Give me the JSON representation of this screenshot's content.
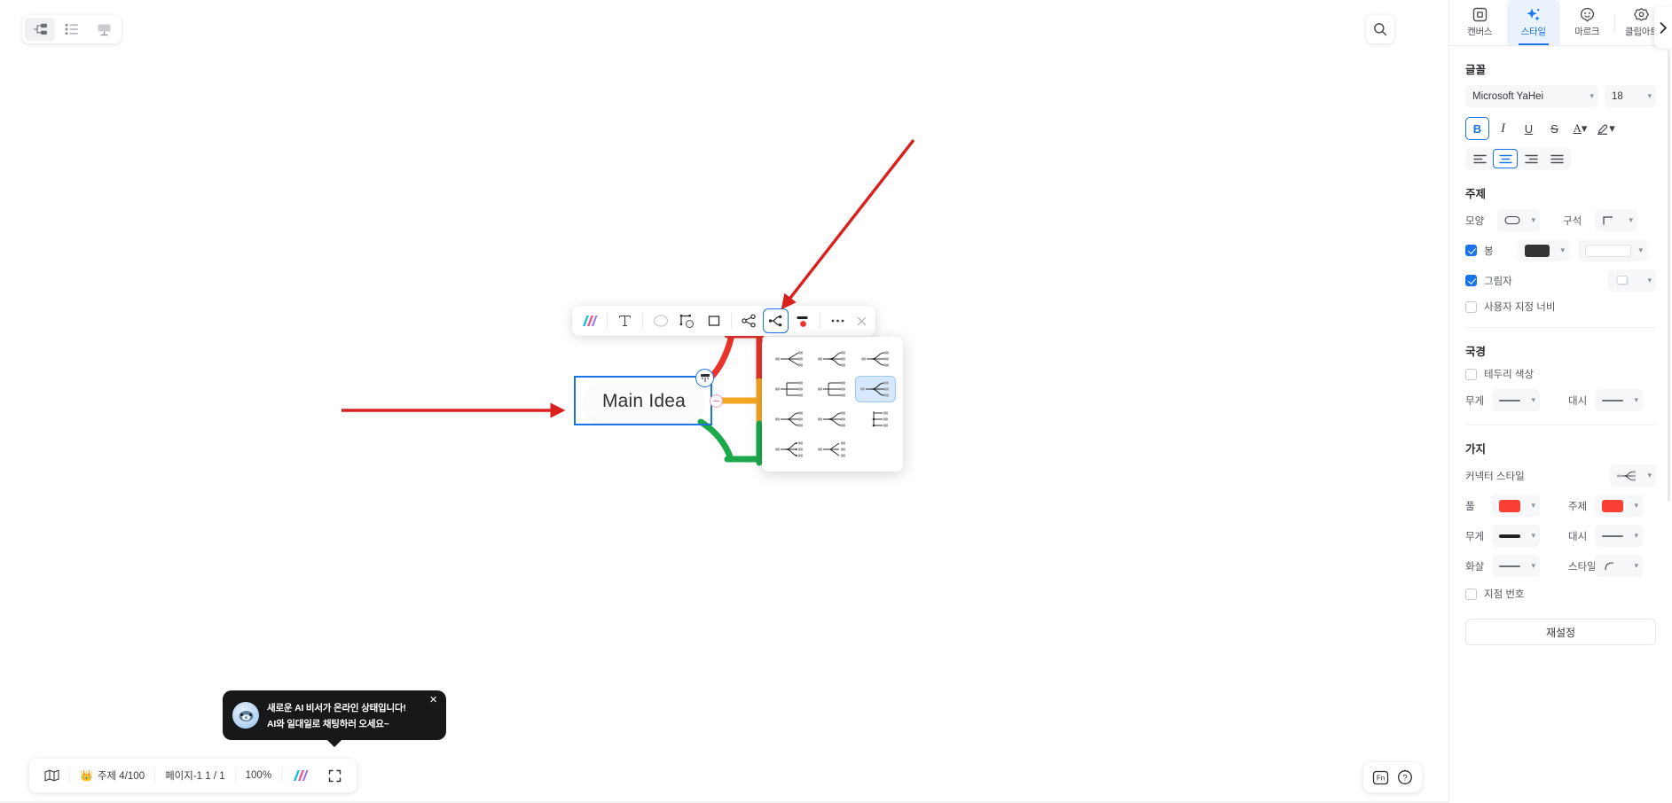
{
  "canvas": {
    "view_switcher": [
      {
        "name": "mindmap-view",
        "icon": "mindmap-icon",
        "active": true
      },
      {
        "name": "outline-view",
        "icon": "list-icon",
        "active": false
      },
      {
        "name": "presentation-view",
        "icon": "slide-icon",
        "active": false
      }
    ],
    "search_icon": "search-icon",
    "collapse_icon": "chevron-right-icon",
    "node": {
      "text": "Main Idea",
      "badge_icon": "collapse-branch-icon",
      "minus_icon": "minus-icon"
    }
  },
  "float_toolbar": {
    "items": [
      {
        "name": "ai-tool",
        "icon": "ai-sparkle-icon",
        "selected": false
      },
      {
        "name": "text-tool",
        "icon": "text-icon",
        "selected": false
      },
      {
        "name": "ellipse-tool",
        "icon": "ellipse-icon",
        "selected": false
      },
      {
        "name": "image-tool",
        "icon": "image-frame-icon",
        "selected": false
      },
      {
        "name": "rectangle-tool",
        "icon": "rectangle-icon",
        "selected": false
      },
      {
        "name": "share-tool",
        "icon": "share-node-icon",
        "selected": false
      },
      {
        "name": "connector-style-tool",
        "icon": "connector-icon",
        "selected": true
      },
      {
        "name": "line-color-tool",
        "icon": "line-color-icon",
        "selected": false
      },
      {
        "name": "more-tool",
        "icon": "more-dots-icon",
        "selected": false
      }
    ],
    "close_label": "×"
  },
  "connector_dropdown": {
    "options": [
      {
        "name": "connector-style-1",
        "shape": "fan-straight",
        "selected": false
      },
      {
        "name": "connector-style-2",
        "shape": "curve-round",
        "selected": false
      },
      {
        "name": "connector-style-3",
        "shape": "curve-round-2",
        "selected": false
      },
      {
        "name": "connector-style-4",
        "shape": "bracket-square",
        "selected": false
      },
      {
        "name": "connector-style-5",
        "shape": "bracket-square-2",
        "selected": false
      },
      {
        "name": "connector-style-6",
        "shape": "curve-round-3",
        "selected": true
      },
      {
        "name": "connector-style-7",
        "shape": "fan-straight-2",
        "selected": false
      },
      {
        "name": "connector-style-8",
        "shape": "curve-round-4",
        "selected": false
      },
      {
        "name": "connector-style-9",
        "shape": "bracket-arrow",
        "selected": false
      },
      {
        "name": "connector-style-10",
        "shape": "curve-arrow",
        "selected": false
      },
      {
        "name": "connector-style-11",
        "shape": "fan-arrow",
        "selected": false
      }
    ]
  },
  "ai_tooltip": {
    "line1": "새로운 AI 비서가 온라인 상태입니다!",
    "line2": "AI와 일대일로 채팅하러 오세요~",
    "avatar_icon": "robot-avatar-icon",
    "close_label": "✕"
  },
  "status_bar": {
    "map_icon": "map-icon",
    "topic_crown": "👑",
    "topic_count": "주제 4/100",
    "page_label": "페이지-1  1 / 1",
    "zoom": "100%",
    "logo_icon": "brand-logo-icon",
    "fullscreen_icon": "fullscreen-icon"
  },
  "bottom_right": {
    "fn_label": "Fn",
    "help_icon": "help-circle-icon"
  },
  "right_panel": {
    "tabs": [
      {
        "label": "캔버스",
        "icon": "canvas-icon",
        "active": false
      },
      {
        "label": "스타일",
        "icon": "sparkle-icon",
        "active": true
      },
      {
        "label": "마르크",
        "icon": "smiley-mark-icon",
        "active": false
      },
      {
        "label": "클립아트",
        "icon": "clipart-icon",
        "active": false
      }
    ],
    "font": {
      "title": "글꼴",
      "family": "Microsoft YaHei",
      "size": "18",
      "bold": {
        "label": "B",
        "active": true
      },
      "italic": {
        "label": "I",
        "active": false
      },
      "underline": {
        "label": "U",
        "active": false
      },
      "strike": {
        "label": "S",
        "active": false
      },
      "text_color": {
        "label": "A",
        "active": false
      },
      "highlight": {
        "label": "✎",
        "active": false
      },
      "align": [
        {
          "name": "align-left",
          "active": false
        },
        {
          "name": "align-center",
          "active": true
        },
        {
          "name": "align-right",
          "active": false
        },
        {
          "name": "align-justify",
          "active": false
        }
      ]
    },
    "topic": {
      "title": "주제",
      "shape_label": "모양",
      "shape_value": "rounded-pill",
      "corner_label": "구석",
      "corner_value": "square-corner",
      "fill_label": "봉",
      "fill_checked": true,
      "fill_color": "#333333",
      "fill_color2": "#ffffff",
      "shadow_label": "그림자",
      "shadow_checked": true,
      "custom_width_label": "사용자 지정 너비",
      "custom_width_checked": false
    },
    "border": {
      "title": "국경",
      "color_label": "테두리 색상",
      "color_checked": false,
      "weight_label": "무게",
      "dash_label": "대시"
    },
    "branch": {
      "title": "가지",
      "connector_label": "커넥터 스타일",
      "fill_label": "풀",
      "fill_color": "#f93e34",
      "topic_label": "주제",
      "topic_color": "#f93e34",
      "weight_label": "무게",
      "dash_label": "대시",
      "arrow_label": "화살",
      "style_label": "스타일",
      "point_number_label": "지점 번호",
      "point_number_checked": false
    },
    "reset_label": "재설정"
  },
  "colors": {
    "accent": "#1a73e8",
    "branch_red": "#e8342a",
    "branch_orange": "#f5a623",
    "branch_green": "#1ca94c",
    "annotation_red": "#d9201c"
  }
}
